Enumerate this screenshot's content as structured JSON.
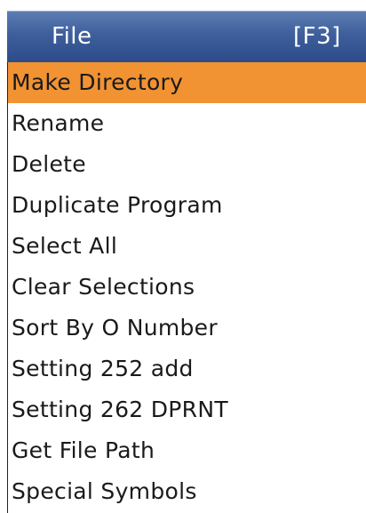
{
  "menu": {
    "title": "File",
    "shortcut": "[F3]",
    "selected_index": 0,
    "items": [
      {
        "label": "Make Directory"
      },
      {
        "label": "Rename"
      },
      {
        "label": "Delete"
      },
      {
        "label": "Duplicate Program"
      },
      {
        "label": "Select All"
      },
      {
        "label": "Clear Selections"
      },
      {
        "label": "Sort By O Number"
      },
      {
        "label": "Setting 252 add"
      },
      {
        "label": "Setting 262 DPRNT"
      },
      {
        "label": "Get File Path"
      },
      {
        "label": "Special Symbols"
      }
    ]
  },
  "colors": {
    "header": "#3f5f9c",
    "highlight": "#f19233",
    "text": "#1a1a1a",
    "header_text": "#ffffff"
  }
}
